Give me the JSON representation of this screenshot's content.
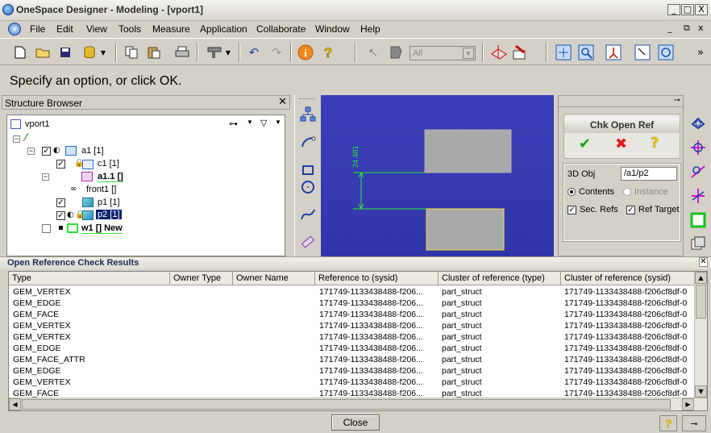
{
  "window": {
    "title": "OneSpace Designer - Modeling - [vport1]",
    "min": "_",
    "max": "□",
    "close": "X",
    "mdi_min": "_",
    "mdi_restore": "⧉",
    "mdi_close": "x"
  },
  "menu": [
    "File",
    "Edit",
    "View",
    "Tools",
    "Measure",
    "Application",
    "Collaborate",
    "Window",
    "Help"
  ],
  "toolbar": {
    "filter_combo": "All",
    "overflow": "»"
  },
  "prompt": "Specify an option, or click OK.",
  "structure_browser": {
    "title": "Structure Browser",
    "close": "✕",
    "root": "vport1",
    "nodes": [
      "a1 [1]",
      "c1 [1]",
      "a1.1 []",
      "front1 []",
      "p1 [1]",
      "p2 [1]",
      "w1 [] New"
    ]
  },
  "viewport": {
    "dimension_label": "24.481"
  },
  "chk_panel": {
    "title": "Chk Open Ref",
    "pin": "⊸",
    "obj_label": "3D Obj",
    "obj_value": "/a1/p2",
    "contents_label": "Contents",
    "instance_label": "Instance",
    "secrefs_label": "Sec. Refs",
    "reftarget_label": "Ref Target"
  },
  "results": {
    "title": "Open Reference Check Results",
    "close": "✕",
    "columns": [
      "Type",
      "Owner Type",
      "Owner Name",
      "Reference to (sysid)",
      "Cluster of reference (type)",
      "Cluster of reference (sysid)"
    ],
    "rows": [
      [
        "GEM_VERTEX",
        "",
        "",
        "171749-1133438488-f206...",
        "part_struct",
        "171749-1133438488-f206cf8df-0"
      ],
      [
        "GEM_EDGE",
        "",
        "",
        "171749-1133438488-f206...",
        "part_struct",
        "171749-1133438488-f206cf8df-0"
      ],
      [
        "GEM_FACE",
        "",
        "",
        "171749-1133438488-f206...",
        "part_struct",
        "171749-1133438488-f206cf8df-0"
      ],
      [
        "GEM_VERTEX",
        "",
        "",
        "171749-1133438488-f206...",
        "part_struct",
        "171749-1133438488-f206cf8df-0"
      ],
      [
        "GEM_VERTEX",
        "",
        "",
        "171749-1133438488-f206...",
        "part_struct",
        "171749-1133438488-f206cf8df-0"
      ],
      [
        "GEM_EDGE",
        "",
        "",
        "171749-1133438488-f206...",
        "part_struct",
        "171749-1133438488-f206cf8df-0"
      ],
      [
        "GEM_FACE_ATTR",
        "",
        "",
        "171749-1133438488-f206...",
        "part_struct",
        "171749-1133438488-f206cf8df-0"
      ],
      [
        "GEM_EDGE",
        "",
        "",
        "171749-1133438488-f206...",
        "part_struct",
        "171749-1133438488-f206cf8df-0"
      ],
      [
        "GEM_VERTEX",
        "",
        "",
        "171749-1133438488-f206...",
        "part_struct",
        "171749-1133438488-f206cf8df-0"
      ],
      [
        "GEM_FACE",
        "",
        "",
        "171749-1133438488-f206...",
        "part_struct",
        "171749-1133438488-f206cf8df-0"
      ]
    ],
    "close_button": "Close"
  },
  "colors": {
    "viewport_bg": "#3036a8",
    "dimension": "#2ee82e",
    "selected_bg": "#0a246a"
  }
}
